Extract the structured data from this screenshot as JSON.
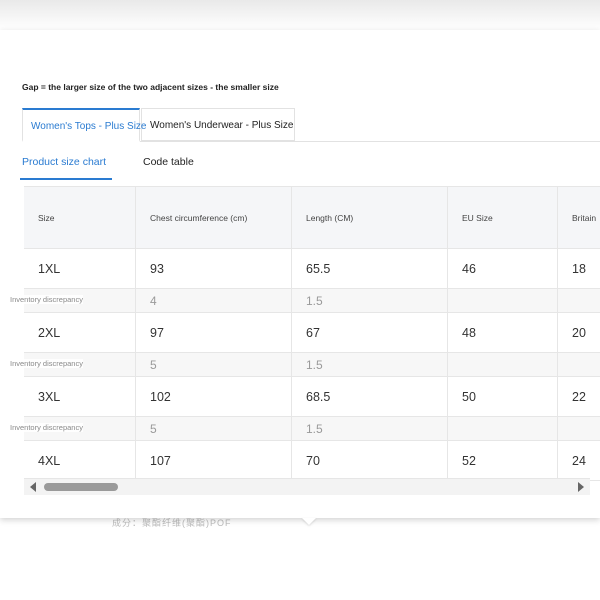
{
  "gap_note": "Gap = the larger size of the two adjacent sizes - the smaller size",
  "tabs": [
    {
      "label": "Women's Tops - Plus Size",
      "active": true
    },
    {
      "label": "Women's Underwear - Plus Size",
      "active": false
    }
  ],
  "subtabs": [
    {
      "label": "Product size chart",
      "active": true
    },
    {
      "label": "Code table",
      "active": false
    }
  ],
  "table": {
    "headers": [
      "Size",
      "Chest circumference (cm)",
      "Length (CM)",
      "EU Size",
      "Britain"
    ],
    "rows": [
      {
        "size": "1XL",
        "chest": "93",
        "length": "65.5",
        "eu": "46",
        "britain": "18"
      },
      {
        "size": "2XL",
        "chest": "97",
        "length": "67",
        "eu": "48",
        "britain": "20"
      },
      {
        "size": "3XL",
        "chest": "102",
        "length": "68.5",
        "eu": "50",
        "britain": "22"
      },
      {
        "size": "4XL",
        "chest": "107",
        "length": "70",
        "eu": "52",
        "britain": "24"
      }
    ],
    "discrepancy_label": "Inventory discrepancy",
    "discrepancies": [
      {
        "chest": "4",
        "length": "1.5"
      },
      {
        "chest": "5",
        "length": "1.5"
      },
      {
        "chest": "5",
        "length": "1.5"
      }
    ]
  },
  "colors": {
    "accent": "#2a7bd1",
    "header_bg": "#f5f6f8",
    "border": "#e6e6e6"
  },
  "background_text": "成分：聚酯纤维(聚酯)POF"
}
